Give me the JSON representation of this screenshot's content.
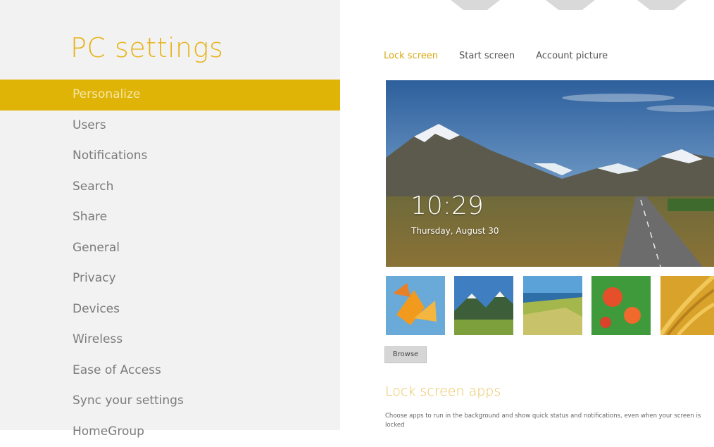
{
  "app": {
    "title": "PC settings"
  },
  "nav": {
    "items": [
      {
        "label": "Personalize",
        "selected": true
      },
      {
        "label": "Users"
      },
      {
        "label": "Notifications"
      },
      {
        "label": "Search"
      },
      {
        "label": "Share"
      },
      {
        "label": "General"
      },
      {
        "label": "Privacy"
      },
      {
        "label": "Devices"
      },
      {
        "label": "Wireless"
      },
      {
        "label": "Ease of Access"
      },
      {
        "label": "Sync your settings"
      },
      {
        "label": "HomeGroup"
      }
    ]
  },
  "tabs": [
    {
      "label": "Lock screen",
      "active": true
    },
    {
      "label": "Start screen"
    },
    {
      "label": "Account picture"
    }
  ],
  "lock_preview": {
    "time": "10:29",
    "date": "Thursday, August 30"
  },
  "thumbnails": [
    {
      "name": "autumn-leaves"
    },
    {
      "name": "mountain-valley"
    },
    {
      "name": "coastline"
    },
    {
      "name": "red-flowers"
    },
    {
      "name": "golden-grass"
    }
  ],
  "browse_button": "Browse",
  "lock_apps": {
    "title": "Lock screen apps",
    "description": "Choose apps to run in the background and show quick status and notifications, even when your screen is locked"
  },
  "colors": {
    "accent": "#e0b307",
    "title": "#e7b316",
    "nav_text": "#7b7b7b",
    "pane_bg": "#f2f2f2"
  }
}
